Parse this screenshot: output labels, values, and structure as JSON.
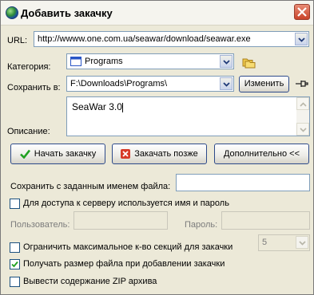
{
  "window": {
    "title": "Добавить закачку"
  },
  "icons": {
    "app": "globe-icon",
    "close": "close-icon",
    "folder": "folders-icon",
    "pin": "pin-icon",
    "start": "checkmark-icon",
    "later": "x-icon",
    "combo": "chevron-down-icon"
  },
  "url": {
    "label": "URL:",
    "value": "http://wwww.one.com.ua/seawar/download/seawar.exe"
  },
  "category": {
    "label": "Категория:",
    "value": "Programs"
  },
  "save_to": {
    "label": "Сохранить в:",
    "value": "F:\\Downloads\\Programs\\",
    "change_button": "Изменить"
  },
  "description": {
    "label": "Описание:",
    "value": "SeaWar 3.0"
  },
  "buttons": {
    "start": "Начать закачку",
    "later": "Закачать позже",
    "advanced": "Дополнительно <<"
  },
  "save_as": {
    "label": "Сохранить с заданным именем файла:",
    "value": ""
  },
  "auth": {
    "checkbox_label": "Для доступа к серверу используется имя и пароль",
    "checked": false,
    "user_label": "Пользователь:",
    "user_value": "",
    "password_label": "Пароль:",
    "password_value": ""
  },
  "limit_sections": {
    "label": "Ограничить максимальное к-во секций для закачки",
    "checked": false,
    "value": "5"
  },
  "get_size": {
    "label": "Получать размер файла при добавлении закачки",
    "checked": true
  },
  "show_zip": {
    "label": "Вывести содержание ZIP архива",
    "checked": false
  },
  "colors": {
    "border_accent": "#7f9db9",
    "button_border": "#2d4a8a",
    "close_red": "#c9432a",
    "check_green": "#21a121"
  }
}
